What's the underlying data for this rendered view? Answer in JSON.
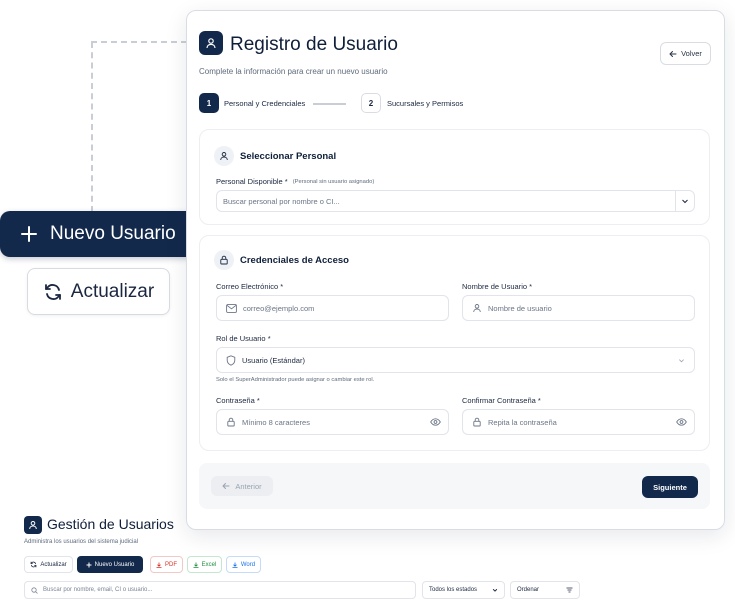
{
  "zoom_callouts": {
    "new_user_label": "Nuevo Usuario",
    "refresh_label": "Actualizar"
  },
  "modal": {
    "title": "Registro de Usuario",
    "subtitle": "Complete la información para crear un nuevo usuario",
    "back_label": "Volver",
    "steps": [
      {
        "number": "1",
        "label": "Personal y Credenciales"
      },
      {
        "number": "2",
        "label": "Sucursales y Permisos"
      }
    ],
    "personal_section": {
      "title": "Seleccionar Personal",
      "field_label": "Personal Disponible *",
      "field_hint": "(Personal sin usuario asignado)",
      "search_placeholder": "Buscar personal por nombre o CI..."
    },
    "credentials_section": {
      "title": "Credenciales de Acceso",
      "email_label": "Correo Electrónico *",
      "email_placeholder": "correo@ejemplo.com",
      "username_label": "Nombre de Usuario *",
      "username_placeholder": "Nombre de usuario",
      "role_label": "Rol de Usuario *",
      "role_value": "Usuario (Estándar)",
      "role_hint": "Solo el SuperAdministrador puede asignar o cambiar este rol.",
      "password_label": "Contraseña *",
      "password_placeholder": "Mínimo 8 caracteres",
      "confirm_label": "Confirmar Contraseña *",
      "confirm_placeholder": "Repita la contraseña"
    },
    "footer": {
      "prev_label": "Anterior",
      "next_label": "Siguiente"
    }
  },
  "page": {
    "title": "Gestión de Usuarios",
    "subtitle": "Administra los usuarios del sistema judicial",
    "toolbar": {
      "refresh": "Actualizar",
      "new_user": "Nuevo Usuario",
      "pdf": "PDF",
      "excel": "Excel",
      "word": "Word"
    },
    "search_placeholder": "Buscar por nombre, email, CI o usuario...",
    "status_filter": "Todos los estados",
    "sort_label": "Ordenar"
  },
  "colors": {
    "primary": "#13294b",
    "pdf": "#d93025",
    "excel": "#1e8e3e",
    "word": "#1a73e8"
  },
  "icons": [
    "plus-icon",
    "refresh-icon",
    "user-icon",
    "arrow-left-icon",
    "lock-icon",
    "mail-icon",
    "shield-icon",
    "eye-icon",
    "chevron-down-icon",
    "search-icon",
    "download-icon",
    "sort-icon"
  ]
}
